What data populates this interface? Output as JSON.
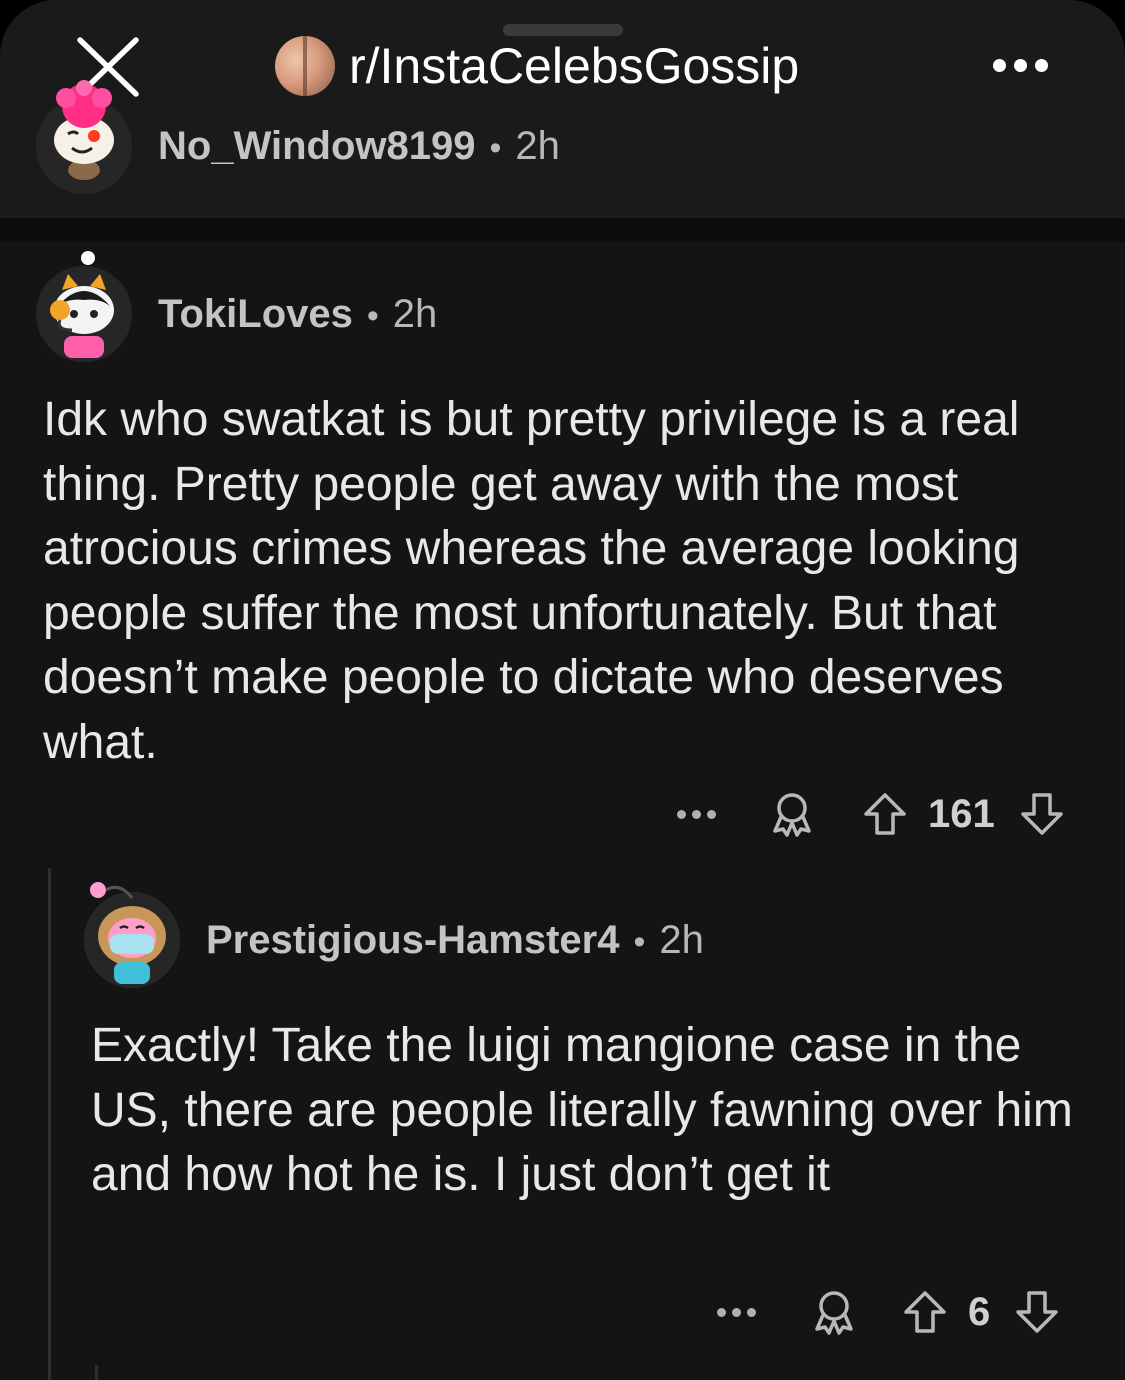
{
  "header": {
    "subreddit": "r/InstaCelebsGossip",
    "close_icon": "close-icon",
    "more_icon": "more-horizontal-icon"
  },
  "post": {
    "author": "No_Window8199",
    "time": "2h"
  },
  "comments": [
    {
      "author": "TokiLoves",
      "time": "2h",
      "text": "Idk who swatkat is but pretty privilege is a real thing. Pretty people get away with the most atrocious crimes whereas the average looking people suffer the most unfortunately. But that doesn’t make people to dictate who deserves what.",
      "votes": "161"
    },
    {
      "author": "Prestigious-Hamster4",
      "time": "2h",
      "text": "Exactly! Take the luigi mangione case in the US, there are people literally fawning over him and how hot he is. I just don’t get it",
      "votes": "6"
    }
  ],
  "separator": "•",
  "colors": {
    "background": "#141414",
    "text": "#e8e8e8",
    "meta": "#b8b8b8"
  }
}
